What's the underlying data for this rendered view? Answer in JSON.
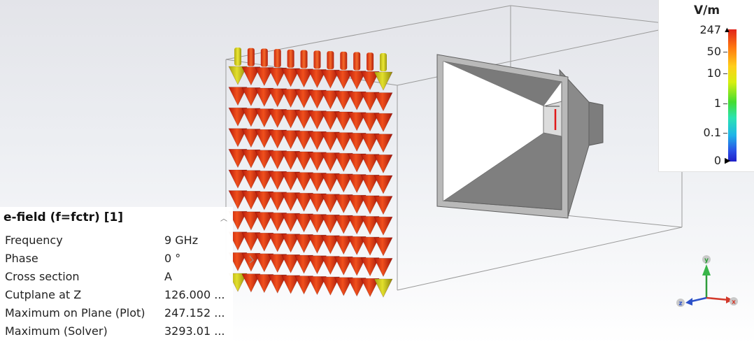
{
  "legend": {
    "unit": "V/m",
    "ticks": [
      "247",
      "50",
      "10",
      "1",
      "0.1",
      "0"
    ]
  },
  "info_panel": {
    "title": "e-field (f=fctr) [1]",
    "collapse_icon": "chevron-up-icon",
    "rows": [
      {
        "label": "Frequency",
        "value": "9 GHz"
      },
      {
        "label": "Phase",
        "value": "0 °"
      },
      {
        "label": "Cross section",
        "value": "A"
      },
      {
        "label": "Cutplane at Z",
        "value": "126.000 ..."
      },
      {
        "label": "Maximum on Plane (Plot)",
        "value": "247.152 ..."
      },
      {
        "label": "Maximum (Solver)",
        "value": "3293.01 ..."
      }
    ]
  },
  "axes": {
    "x": "x",
    "y": "y",
    "z": "z"
  },
  "colors": {
    "arrow_hot": "#d9260f",
    "arrow_mid": "#e8561a",
    "arrow_edge": "#c9c51a",
    "horn_metal": "#8e8e8e",
    "axis_x": "#d33a2c",
    "axis_y": "#2e9c3a",
    "axis_z": "#2d52c9"
  }
}
